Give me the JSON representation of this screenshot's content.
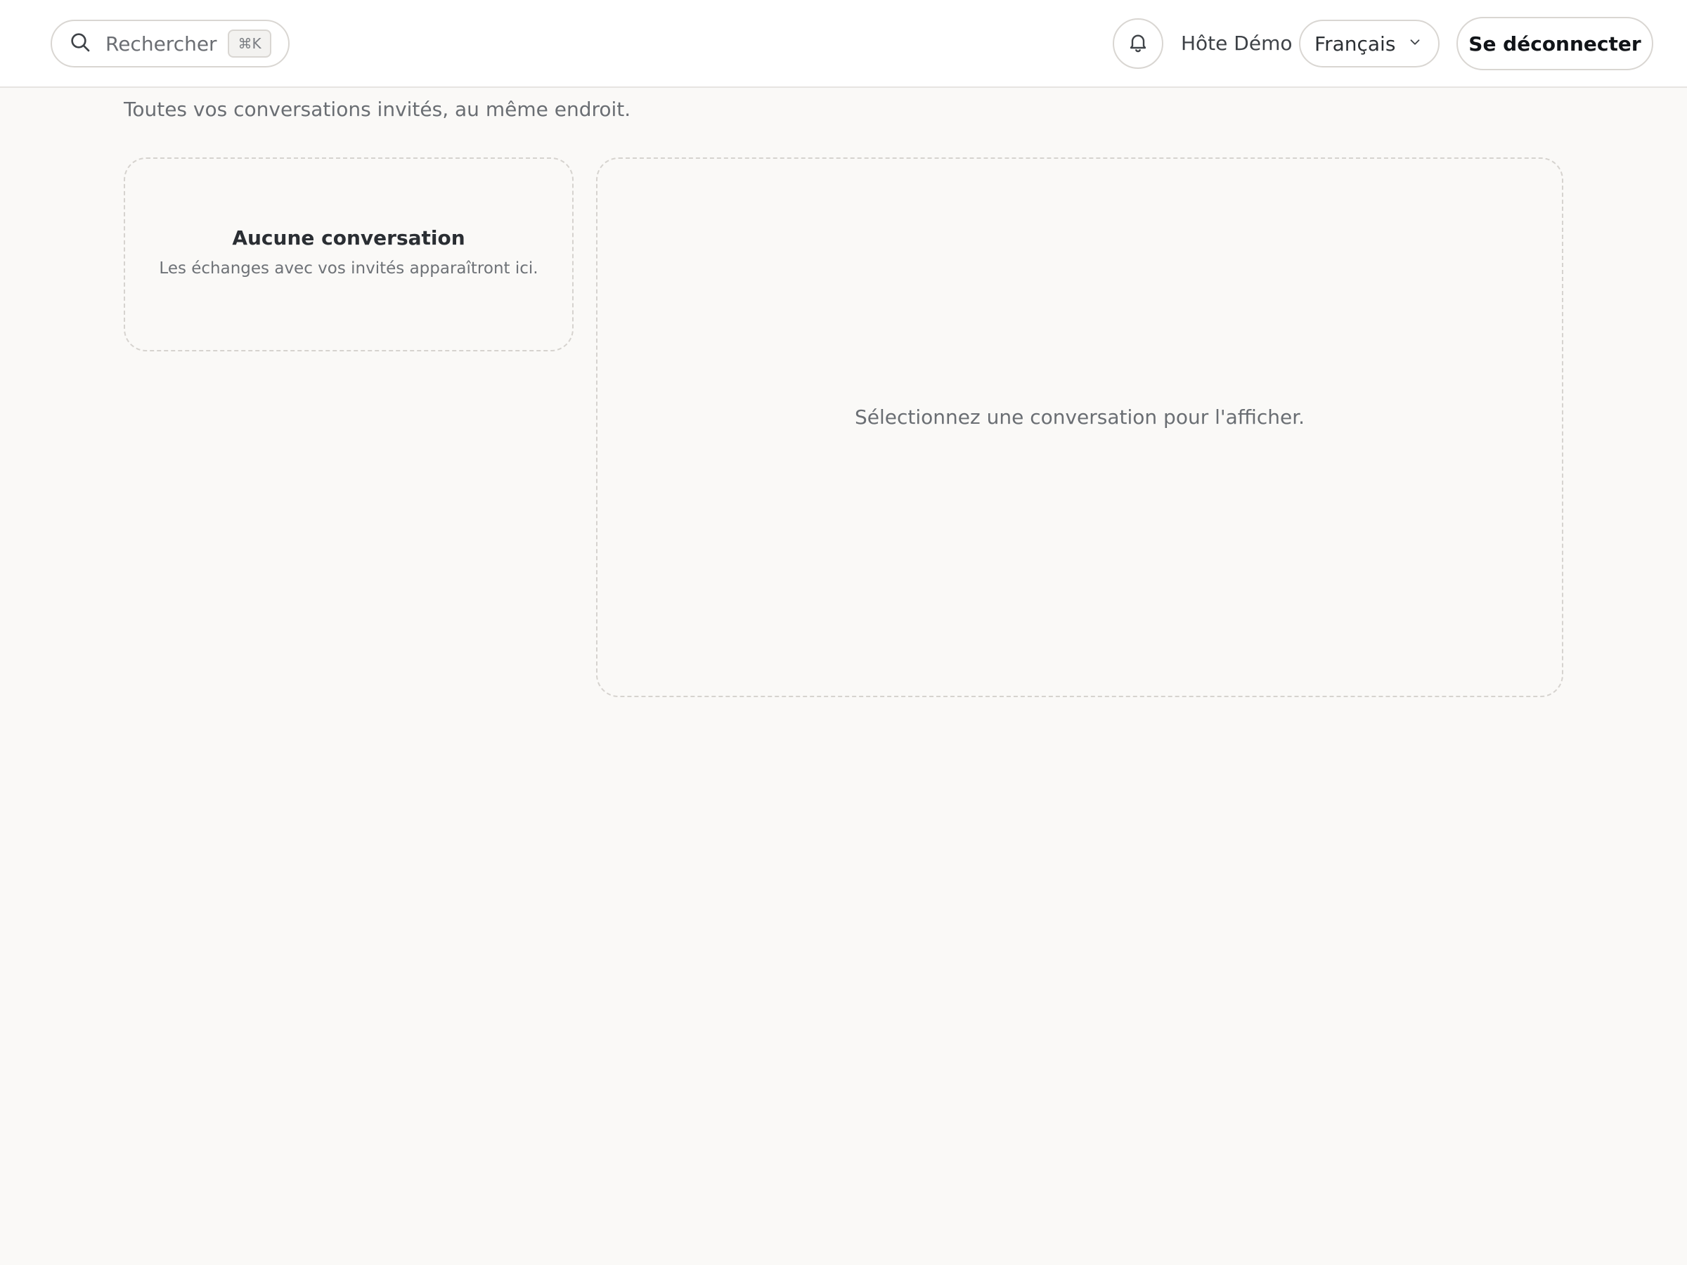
{
  "header": {
    "search": {
      "placeholder": "Rechercher",
      "shortcut": "⌘K",
      "icon": "search-icon"
    },
    "notifications_icon": "bell-icon",
    "user_name": "Hôte Démo",
    "language": {
      "selected": "Français",
      "icon": "chevron-down-icon"
    },
    "logout_label": "Se déconnecter"
  },
  "page": {
    "subtitle": "Toutes vos conversations invités, au même endroit."
  },
  "conversation_list": {
    "empty_title": "Aucune conversation",
    "empty_description": "Les échanges avec vos invités apparaîtront ici."
  },
  "conversation_detail": {
    "placeholder": "Sélectionnez une conversation pour l'afficher."
  }
}
